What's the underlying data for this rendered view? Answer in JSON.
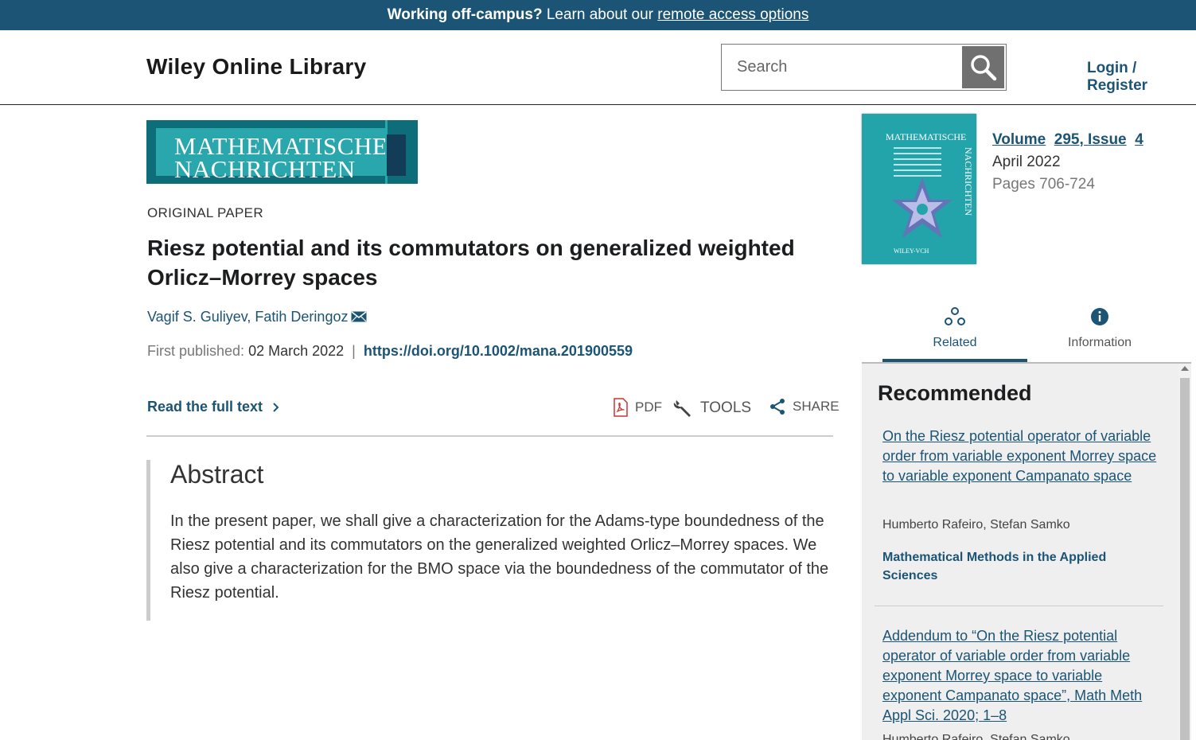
{
  "banner": {
    "bold": "Working off-campus?",
    "text": " Learn about our ",
    "link": "remote access options"
  },
  "header": {
    "logo": "Wiley Online Library",
    "search_placeholder": "Search",
    "login": "Login / Register"
  },
  "journal": {
    "banner_line1": "MATHEMATISCHE",
    "banner_line2": "NACHRICHTEN",
    "cover_title": "MATHEMATISCHE",
    "cover_vertical": "NACHRICHTEN",
    "cover_publisher": "WILEY-VCH",
    "volume_label": "Volume",
    "volume_issue": "295, Issue",
    "issue_number": "4",
    "month": "April 2022",
    "pages": "Pages 706-724"
  },
  "article": {
    "type": "ORIGINAL PAPER",
    "title": "Riesz potential and its commutators on generalized weighted Orlicz–Morrey spaces",
    "author1": "Vagif S. Guliyev",
    "author2": "Fatih Deringoz",
    "first_published_label": "First published:",
    "first_published_date": "02 March 2022",
    "doi": "https://doi.org/10.1002/mana.201900559",
    "read_full_text": "Read the full text"
  },
  "tools": {
    "pdf": "PDF",
    "tools": "TOOLS",
    "share": "SHARE"
  },
  "abstract": {
    "heading": "Abstract",
    "text": "In the present paper, we shall give a characterization for the Adams-type boundedness of the Riesz potential and its commutators on the generalized weighted Orlicz–Morrey spaces. We also give a characterization for the BMO space via the boundedness of the commutator of the Riesz potential."
  },
  "sidebar": {
    "tab_related": "Related",
    "tab_information": "Information",
    "recommended_heading": "Recommended",
    "recommended": [
      {
        "title": "On the Riesz potential operator of variable order from variable exponent Morrey space to variable exponent Campanato space",
        "authors": "Humberto Rafeiro, Stefan Samko",
        "journal": "Mathematical Methods in the Applied Sciences"
      },
      {
        "title": "Addendum to “On the Riesz potential operator of variable order from variable exponent Morrey space to variable exponent Campanato space”, Math Meth Appl Sci. 2020; 1–8",
        "authors": "Humberto Rafeiro, Stefan Samko"
      }
    ]
  },
  "colors": {
    "brand": "#1b5474",
    "journal_teal": "#2aa6ad",
    "journal_dark": "#0d6d78"
  }
}
